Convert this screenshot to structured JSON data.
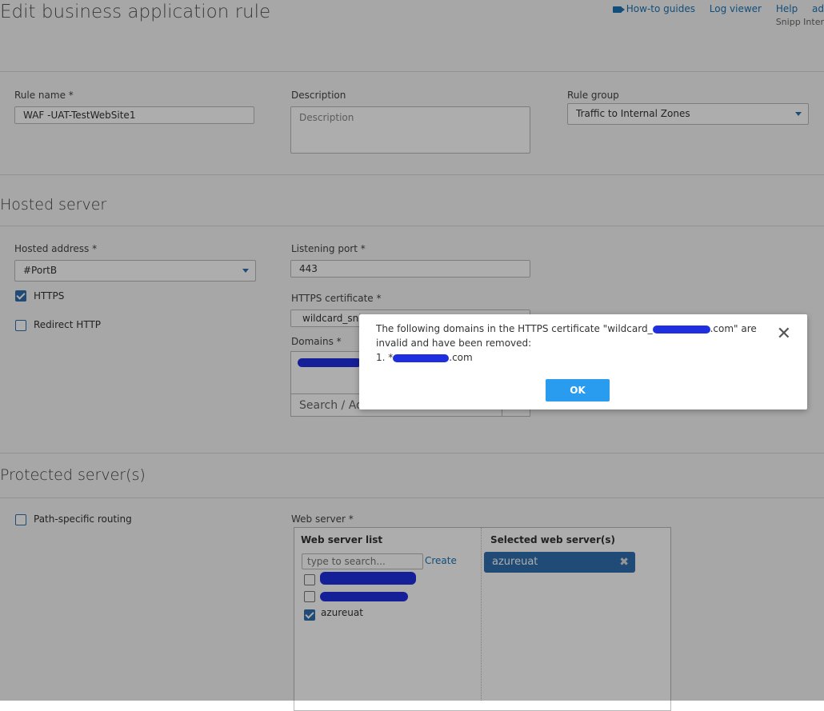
{
  "header": {
    "title": "Edit business application rule",
    "links": [
      "How-to guides",
      "Log viewer",
      "Help",
      "ad"
    ],
    "subtitle": "Snipp Inter"
  },
  "rule": {
    "name_label": "Rule name *",
    "name_value": "WAF -UAT-TestWebSite1",
    "description_label": "Description",
    "description_placeholder": "Description",
    "group_label": "Rule group",
    "group_value": "Traffic to Internal Zones"
  },
  "hosted": {
    "section_title": "Hosted server",
    "address_label": "Hosted address *",
    "address_value": "#PortB",
    "https_label": "HTTPS",
    "redirect_label": "Redirect HTTP",
    "port_label": "Listening port *",
    "port_value": "443",
    "cert_label": "HTTPS certificate *",
    "cert_value": "wildcard_sni",
    "domains_label": "Domains *",
    "search_placeholder": "Search / Ad"
  },
  "protected": {
    "section_title": "Protected server(s)",
    "path_label": "Path-specific routing",
    "web_server_label": "Web server *",
    "list_title": "Web server list",
    "search_placeholder": "type to search...",
    "create_label": "Create",
    "selected_title": "Selected web server(s)",
    "items": [
      "azureuat"
    ],
    "selected": [
      "azureuat"
    ]
  },
  "dialog": {
    "line1_prefix": "The following domains in the HTTPS certificate \"wildcard_",
    "line1_suffix": ".com\" are",
    "line2": "invalid and have been removed:",
    "line3_prefix": "1. *",
    "line3_suffix": ".com",
    "ok_label": "OK"
  },
  "colors": {
    "accent": "#2f6fae",
    "ok_button": "#2a9cf0",
    "link": "#1a73b5",
    "redaction": "#1f2fe0"
  }
}
